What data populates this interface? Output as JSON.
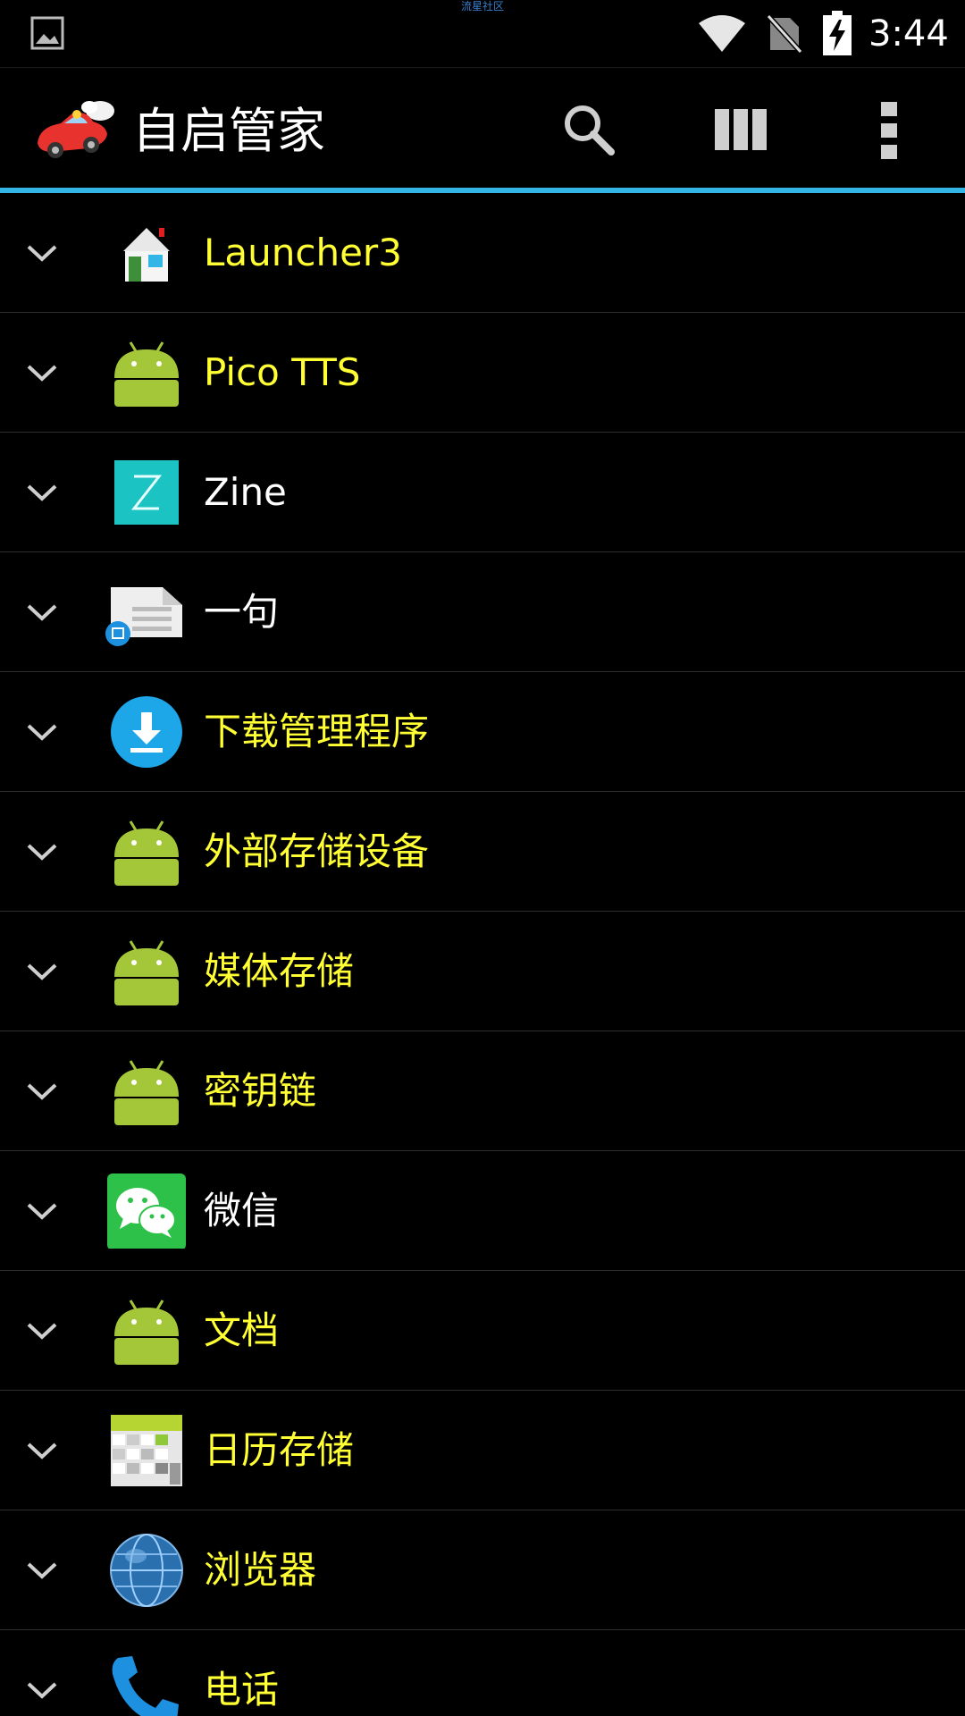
{
  "status_bar": {
    "watermark": "流星社区",
    "time": "3:44",
    "icons": [
      "gallery-icon",
      "wifi-icon",
      "no-sim-icon",
      "battery-charging-icon"
    ]
  },
  "action_bar": {
    "title": "自启管家",
    "icons": [
      "app-logo-icon",
      "search-icon",
      "columns-icon",
      "overflow-menu-icon"
    ]
  },
  "colors": {
    "accent": "#33b5e5",
    "system_app_label": "#ffff33",
    "user_app_label": "#ffffff",
    "background": "#000000"
  },
  "apps": [
    {
      "name": "Launcher3",
      "icon": "launcher3-icon",
      "label_color": "yellow"
    },
    {
      "name": "Pico TTS",
      "icon": "android-icon",
      "label_color": "yellow"
    },
    {
      "name": "Zine",
      "icon": "zine-icon",
      "label_color": "white"
    },
    {
      "name": "一句",
      "icon": "yiju-icon",
      "label_color": "white"
    },
    {
      "name": "下载管理程序",
      "icon": "download-icon",
      "label_color": "yellow"
    },
    {
      "name": "外部存储设备",
      "icon": "android-icon",
      "label_color": "yellow"
    },
    {
      "name": "媒体存储",
      "icon": "android-icon",
      "label_color": "yellow"
    },
    {
      "name": "密钥链",
      "icon": "android-icon",
      "label_color": "yellow"
    },
    {
      "name": "微信",
      "icon": "wechat-icon",
      "label_color": "white"
    },
    {
      "name": "文档",
      "icon": "android-icon",
      "label_color": "yellow"
    },
    {
      "name": "日历存储",
      "icon": "calendar-storage-icon",
      "label_color": "yellow"
    },
    {
      "name": "浏览器",
      "icon": "browser-globe-icon",
      "label_color": "yellow"
    },
    {
      "name": "电话",
      "icon": "phone-icon",
      "label_color": "yellow"
    }
  ]
}
